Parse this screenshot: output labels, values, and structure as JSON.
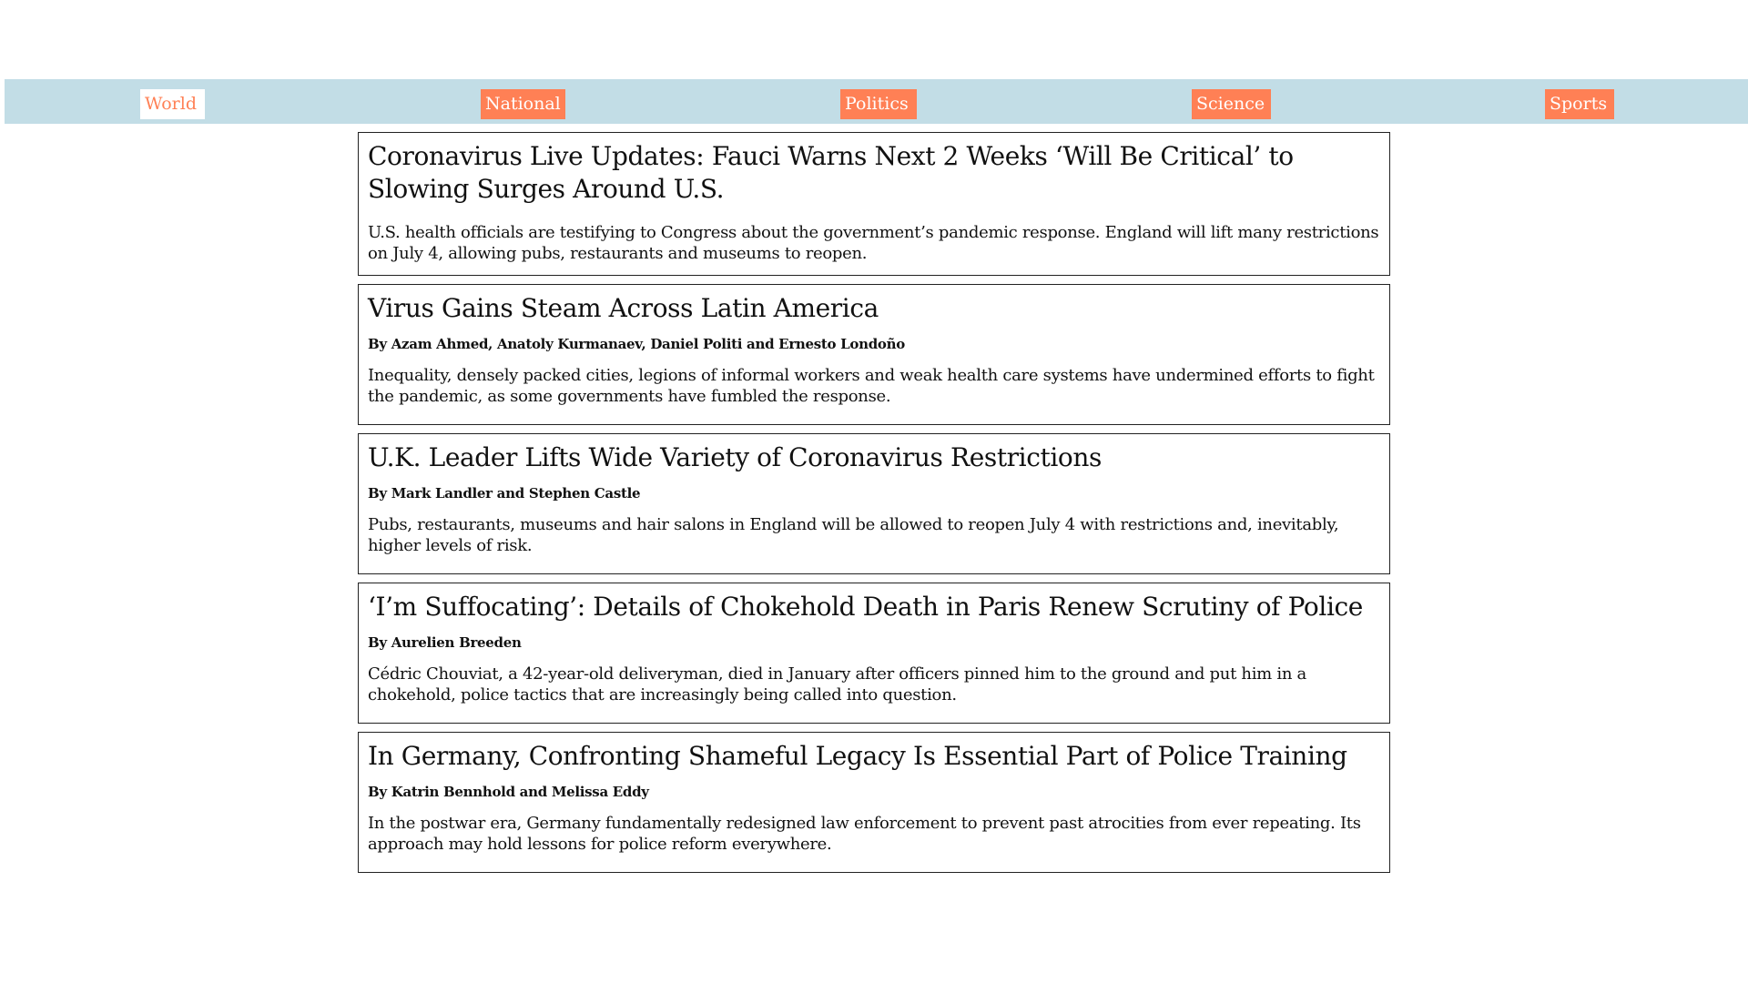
{
  "nav": {
    "tabs": [
      {
        "label": "World",
        "active": true
      },
      {
        "label": "National",
        "active": false
      },
      {
        "label": "Politics",
        "active": false
      },
      {
        "label": "Science",
        "active": false
      },
      {
        "label": "Sports",
        "active": false
      }
    ]
  },
  "articles": [
    {
      "title": "Coronavirus Live Updates: Fauci Warns Next 2 Weeks ‘Will Be Critical’ to Slowing Surges Around U.S.",
      "byline": "",
      "summary": "U.S. health officials are testifying to Congress about the government’s pandemic response. England will lift many restrictions on July 4, allowing pubs, restaurants and museums to reopen."
    },
    {
      "title": "Virus Gains Steam Across Latin America",
      "byline": "By Azam Ahmed, Anatoly Kurmanaev, Daniel Politi and Ernesto Londoño",
      "summary": "Inequality, densely packed cities, legions of informal workers and weak health care systems have undermined efforts to fight the pandemic, as some governments have fumbled the response."
    },
    {
      "title": "U.K. Leader Lifts Wide Variety of Coronavirus Restrictions",
      "byline": "By Mark Landler and Stephen Castle",
      "summary": "Pubs, restaurants, museums and hair salons in England will be allowed to reopen July 4 with restrictions and, inevitably, higher levels of risk."
    },
    {
      "title": "‘I’m Suffocating’: Details of Chokehold Death in Paris Renew Scrutiny of Police",
      "byline": "By Aurelien Breeden",
      "summary": "Cédric Chouviat, a 42-year-old deliveryman, died in January after officers pinned him to the ground and put him in a chokehold, police tactics that are increasingly being called into question."
    },
    {
      "title": "In Germany, Confronting Shameful Legacy Is Essential Part of Police Training",
      "byline": "By Katrin Bennhold and Melissa Eddy",
      "summary": "In the postwar era, Germany fundamentally redesigned law enforcement to prevent past atrocities from ever repeating. Its approach may hold lessons for police reform everywhere."
    }
  ],
  "colors": {
    "nav_background": "#c2dde6",
    "tab_background": "#ff8055",
    "tab_text": "#ffffff",
    "active_tab_background": "#ffffff",
    "active_tab_text": "#ff8055"
  }
}
